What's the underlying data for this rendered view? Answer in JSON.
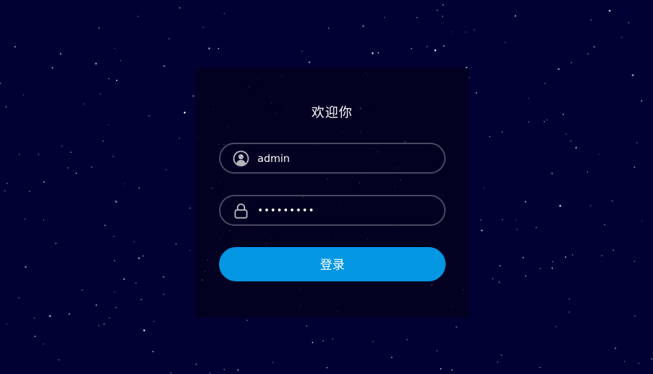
{
  "colors": {
    "background": "#020134",
    "panel": "#03011e",
    "field_border": "#4c4a63",
    "button": "#0396e3",
    "text": "#ffffff",
    "icon": "#b4b4be"
  },
  "login": {
    "title": "欢迎你",
    "username": {
      "icon": "user-avatar-icon",
      "value": "admin"
    },
    "password": {
      "icon": "lock-icon",
      "value": "•••••••••"
    },
    "submit_label": "登录"
  }
}
